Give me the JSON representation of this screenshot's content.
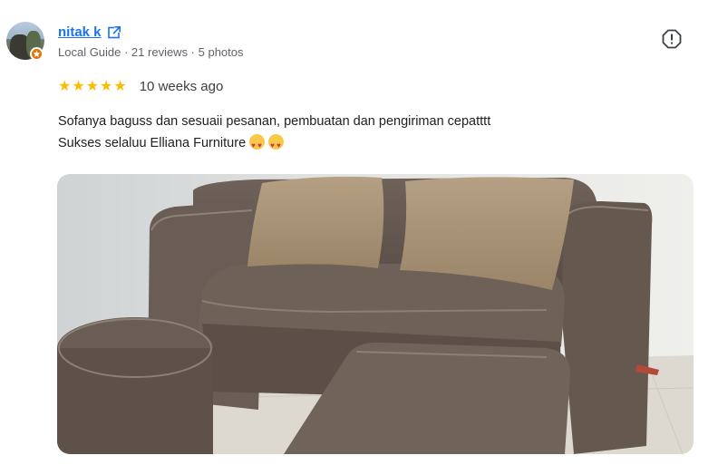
{
  "reviewer": {
    "name": "nitak k",
    "meta": "Local Guide · 21 reviews · 5 photos"
  },
  "review": {
    "rating": 5,
    "stars": [
      "★",
      "★",
      "★",
      "★",
      "★"
    ],
    "time": "10 weeks ago",
    "line1": "Sofanya baguss dan sesuaii pesanan, pembuatan dan pengiriman cepatttt",
    "line2": "Sukses selaluu Elliana Furniture",
    "emojis": [
      "star-struck-emoji",
      "star-struck-emoji"
    ]
  },
  "colors": {
    "link": "#1a73e8",
    "star": "#fbbc04",
    "badge": "#e8710a",
    "meta": "#5f6368"
  },
  "icons": {
    "external": "open-in-new-icon",
    "report": "report-flag-icon",
    "badge": "local-guide-badge-icon"
  }
}
